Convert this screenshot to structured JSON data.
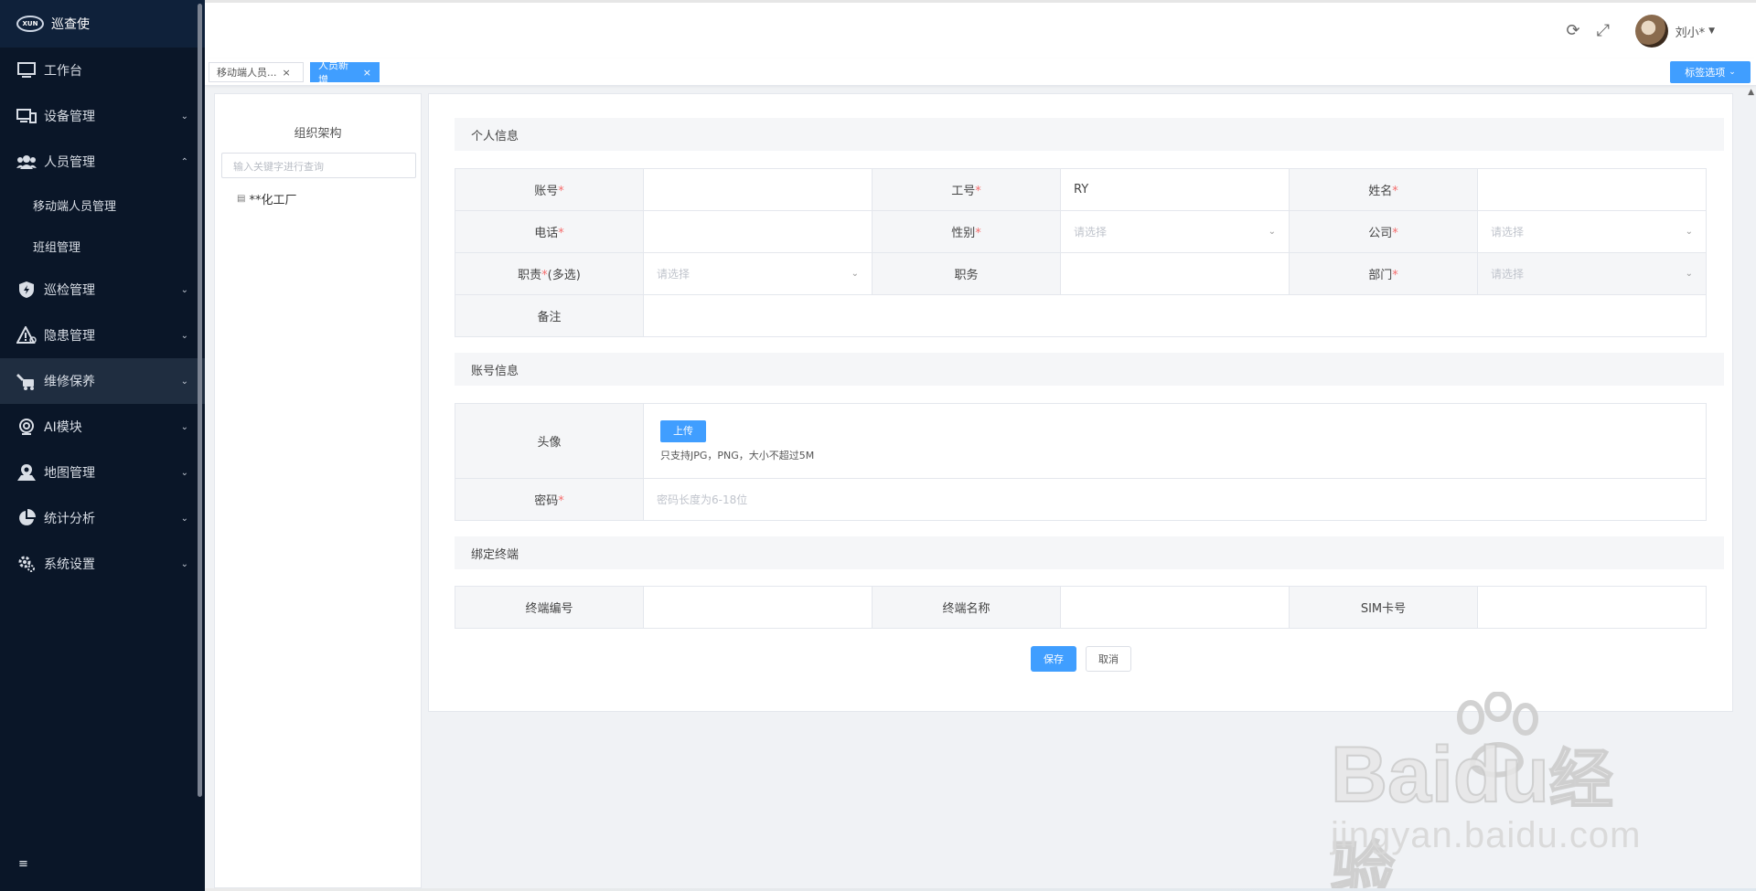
{
  "app": {
    "title": "巡查使",
    "logo_text": "XUN"
  },
  "sidebar": {
    "items": [
      {
        "label": "工作台",
        "icon": "monitor-icon"
      },
      {
        "label": "设备管理",
        "icon": "devices-icon"
      },
      {
        "label": "人员管理",
        "icon": "users-icon"
      },
      {
        "label": "巡检管理",
        "icon": "shield-bolt-icon"
      },
      {
        "label": "隐患管理",
        "icon": "warning-icon"
      },
      {
        "label": "维修保养",
        "icon": "maintenance-icon"
      },
      {
        "label": "AI模块",
        "icon": "camera-icon"
      },
      {
        "label": "地图管理",
        "icon": "map-pin-icon"
      },
      {
        "label": "统计分析",
        "icon": "pie-chart-icon"
      },
      {
        "label": "系统设置",
        "icon": "gear-icon"
      }
    ],
    "submenu": [
      "移动端人员管理",
      "班组管理"
    ]
  },
  "header": {
    "user_name": "刘小*"
  },
  "tabs": [
    {
      "label": "移动端人员..."
    },
    {
      "label": "人员新增"
    }
  ],
  "tab_options_label": "标签选项",
  "org": {
    "title": "组织架构",
    "search_placeholder": "输入关键字进行查询",
    "root_node": "**化工厂"
  },
  "personal": {
    "section_title": "个人信息",
    "account_label": "账号",
    "job_no_label": "工号",
    "job_no_value": "RY",
    "name_label": "姓名",
    "phone_label": "电话",
    "gender_label": "性别",
    "gender_placeholder": "请选择",
    "company_label": "公司",
    "company_placeholder": "请选择",
    "duty_label": "职责",
    "duty_suffix": "(多选)",
    "duty_placeholder": "请选择",
    "position_label": "职务",
    "dept_label": "部门",
    "dept_placeholder": "请选择",
    "remark_label": "备注"
  },
  "account": {
    "section_title": "账号信息",
    "avatar_label": "头像",
    "upload_label": "上传",
    "upload_tip": "只支持JPG，PNG，大小不超过5M",
    "password_label": "密码",
    "password_placeholder": "密码长度为6-18位"
  },
  "terminal": {
    "section_title": "绑定终端",
    "terminal_no_label": "终端编号",
    "terminal_name_label": "终端名称",
    "sim_label": "SIM卡号"
  },
  "actions": {
    "save_label": "保存",
    "cancel_label": "取消"
  },
  "watermark": {
    "brand": "Bai",
    "brand_suffix": "du",
    "cn": "经验",
    "url": "jingyan.baidu.com"
  },
  "colors": {
    "primary": "#409eff",
    "sidebar_bg": "#0a1628",
    "required": "#f56c6c"
  }
}
